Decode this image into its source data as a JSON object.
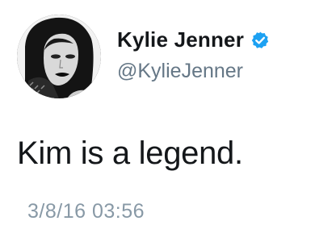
{
  "author": {
    "display_name": "Kylie Jenner",
    "handle": "@KylieJenner",
    "verified": true,
    "verified_icon": "verified-badge-icon",
    "avatar_icon": "profile-photo"
  },
  "tweet": {
    "text": "Kim is a legend.",
    "timestamp": "3/8/16 03:56"
  },
  "colors": {
    "name": "#14171a",
    "handle": "#657786",
    "timestamp": "#8899a6",
    "verified": "#1da1f2",
    "background": "#ffffff"
  }
}
